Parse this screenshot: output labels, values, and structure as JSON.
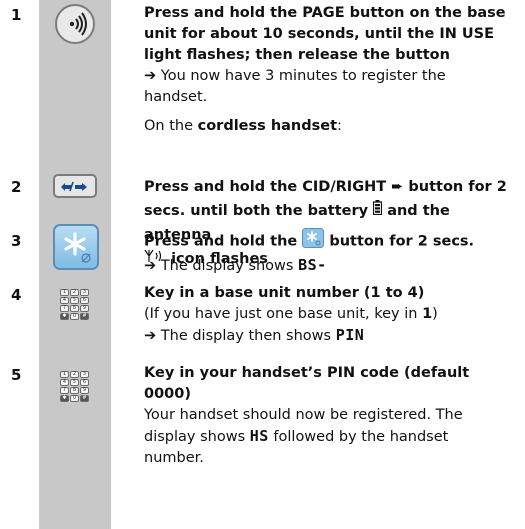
{
  "steps": [
    {
      "number": "1",
      "icon": "page-button-icon",
      "lines": [
        "Press and hold the PAGE button on the base",
        "unit for about 10 seconds, until the IN USE",
        "light flashes; then release the button"
      ],
      "result_arrow": "➔",
      "result_text_1": "You now have 3 minutes to register the",
      "result_text_2": "handset.",
      "note_prefix": "On the ",
      "note_bold": "cordless handset",
      "note_suffix": ":"
    },
    {
      "number": "2",
      "icon": "cid-right-button-icon",
      "line1": "Press and hold the CID/RIGHT ➨ button for 2",
      "line2_prefix": "secs. until both the battery",
      "line2_mid": "and the antenna",
      "line3_suffix": "icon flashes"
    },
    {
      "number": "3",
      "icon": "star-button-icon",
      "line1_prefix": "Press and hold the",
      "line1_suffix": "button for 2 secs.",
      "result_arrow": "➔",
      "result_text": "The display shows",
      "display_value": "BS-"
    },
    {
      "number": "4",
      "icon": "keypad-icon",
      "line1": "Key in a base unit number (1 to 4)",
      "line2_prefix": "(If you have just one base unit, key in",
      "line2_bold": "1",
      "line2_suffix": ")",
      "result_arrow": "➔",
      "result_text": "The display then shows",
      "display_value": "PIN"
    },
    {
      "number": "5",
      "icon": "keypad-icon",
      "line1": "Key in your handset’s PIN code (default",
      "line2": "0000)",
      "line3": "Your handset should now be registered. The",
      "line4_prefix": "display shows",
      "display_value": "HS",
      "line4_suffix": "followed by the handset",
      "line5": "number."
    }
  ],
  "keypad_keys": [
    "1",
    "2",
    "3",
    "4",
    "5",
    "6",
    "7",
    "8",
    "9",
    "✱",
    "0",
    "#"
  ],
  "colors": {
    "gutter": "#c8c8c8",
    "star_button": "#8cc3e8"
  }
}
